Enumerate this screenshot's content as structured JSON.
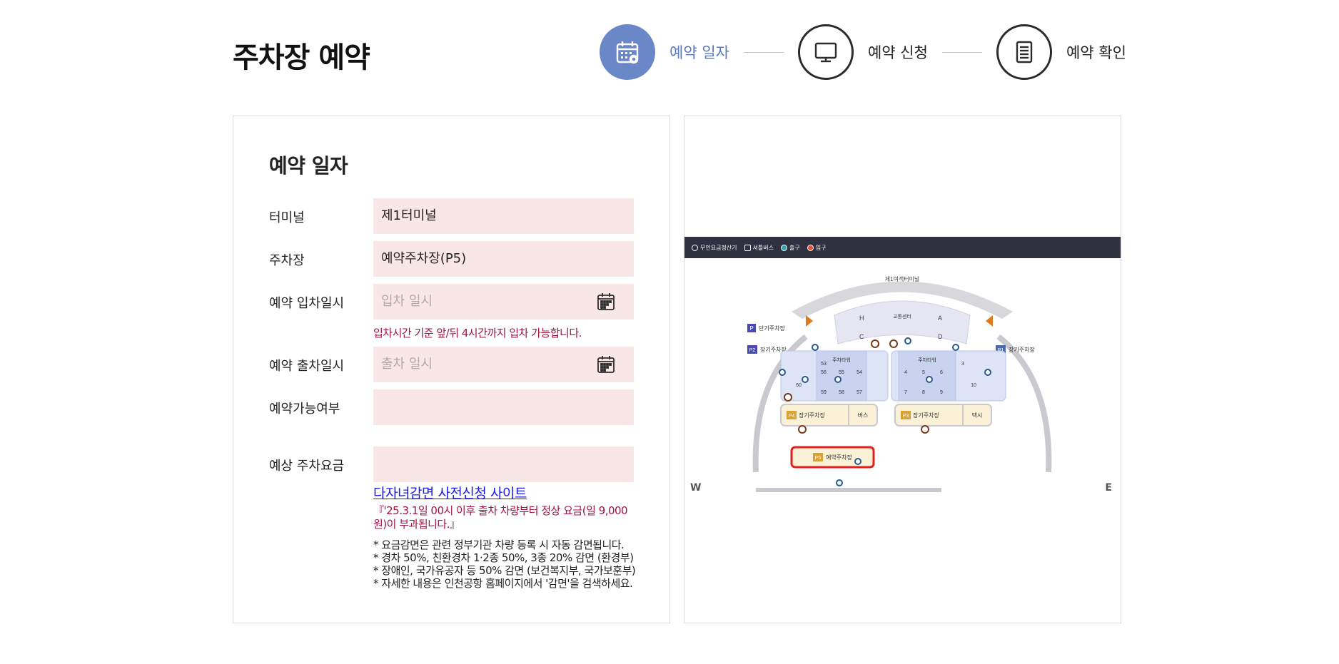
{
  "header": {
    "title": "주차장 예약",
    "steps": [
      {
        "label": "예약 일자",
        "icon": "calendar-icon",
        "active": true
      },
      {
        "label": "예약 신청",
        "icon": "monitor-icon",
        "active": false
      },
      {
        "label": "예약 확인",
        "icon": "document-icon",
        "active": false
      }
    ]
  },
  "form": {
    "section_title": "예약 일자",
    "terminal_label": "터미널",
    "terminal_value": "제1터미널",
    "parking_label": "주차장",
    "parking_value": "예약주차장(P5)",
    "entry_label": "예약 입차일시",
    "entry_placeholder": "입차 일시",
    "entry_hint": "입차시간 기준 앞/뒤 4시간까지 입차 가능합니다.",
    "exit_label": "예약 출차일시",
    "exit_placeholder": "출차 일시",
    "availability_label": "예약가능여부",
    "availability_value": "",
    "fee_label": "예상 주차요금",
    "fee_value": "",
    "discount_link": "다자녀감면 사전신청 사이트",
    "notice": "『'25.3.1일 00시 이후 출차 차량부터 정상 요금(일 9,000원)이 부과됩니다.』",
    "notes": [
      "* 요금감면은 관련 정부기관 차량 등록 시 자동 감면됩니다.",
      "* 경차 50%, 친환경차 1·2종 50%, 3종 20% 감면 (환경부)",
      "* 장애인, 국가유공자 등 50% 감면 (보건복지부, 국가보훈부)",
      "* 자세한 내용은 인천공항 홈페이지에서 '감면'을 검색하세요."
    ]
  },
  "map": {
    "legend": [
      "무인요금정산기",
      "셔틀버스",
      "출구",
      "입구"
    ],
    "terminal_label": "제1여객터미널",
    "transport_center": "교통센터",
    "zones": [
      "H",
      "A",
      "C",
      "D"
    ],
    "p_short": "단기주차장",
    "p2_label": "장기주차장",
    "p1_label": "장기주차장",
    "p4_label": "장기주차장",
    "p3_label": "장기주차장",
    "p5_label": "예약주차장",
    "bus_label": "버스",
    "taxi_label": "택시",
    "tower_label": "주차타워",
    "compass_west": "W",
    "compass_east": "E",
    "colors": {
      "accent": "#6a87c8",
      "highlight": "#e02020",
      "legend_bg": "#2f3140"
    }
  }
}
